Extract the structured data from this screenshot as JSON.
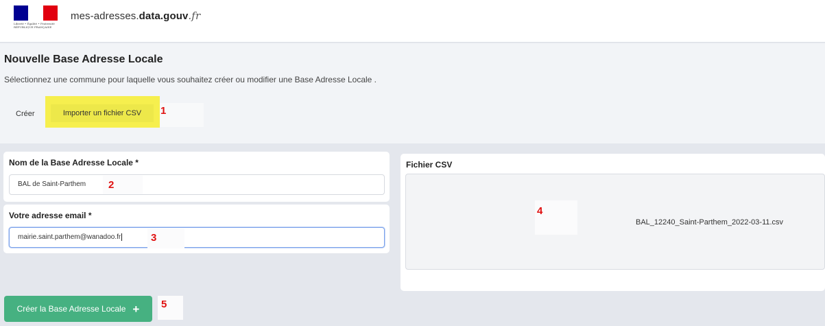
{
  "header": {
    "brand_prefix": "mes-adresses.",
    "brand_bold": "data.gouv",
    "brand_suffix": ".fr",
    "logo_caption": "Liberté • Égalité • Fraternité RÉPUBLIQUE FRANÇAISE",
    "flag_colors": [
      "#000091",
      "#ffffff",
      "#e1000f"
    ]
  },
  "intro": {
    "title": "Nouvelle Base Adresse Locale",
    "description": "Sélectionnez une commune pour laquelle vous souhaitez créer ou modifier une Base Adresse Locale ."
  },
  "tabs": {
    "create_label": "Créer",
    "import_label": "Importer un fichier CSV",
    "highlight_color": "#f6ef4e"
  },
  "form": {
    "name_label": "Nom de la Base Adresse Locale *",
    "name_value": "BAL de Saint-Parthem",
    "email_label": "Votre adresse email *",
    "email_value": "mairie.saint.parthem@wanadoo.fr"
  },
  "csv": {
    "label": "Fichier CSV",
    "filename": "BAL_12240_Saint-Parthem_2022-03-11.csv"
  },
  "create_button": {
    "label": "Créer la Base Adresse Locale",
    "icon": "plus-icon",
    "color": "#46b181"
  },
  "annotations": {
    "a1": "1",
    "a2": "2",
    "a3": "3",
    "a4": "4",
    "a5": "5",
    "color": "#e01010"
  }
}
